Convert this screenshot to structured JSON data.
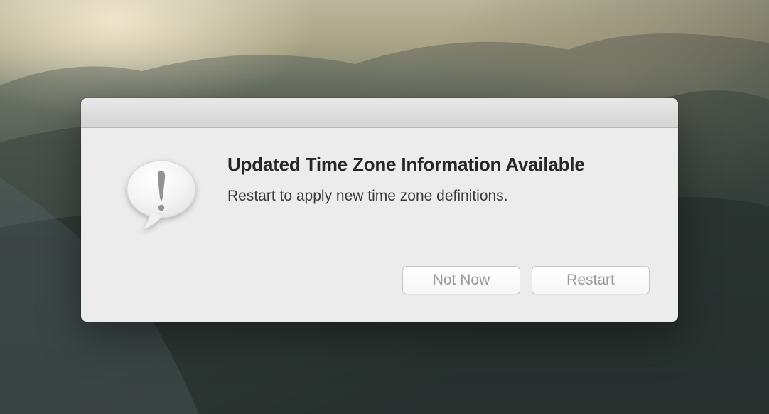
{
  "dialog": {
    "title": "Updated Time Zone Information Available",
    "message": "Restart to apply new time zone definitions.",
    "buttons": {
      "secondary": "Not Now",
      "primary": "Restart"
    }
  }
}
